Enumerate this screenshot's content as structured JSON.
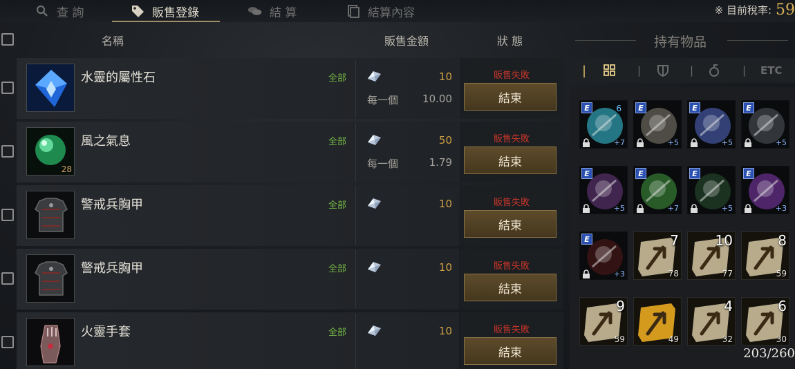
{
  "tabs": [
    {
      "label": "查 詢",
      "icon": "search-icon",
      "active": false
    },
    {
      "label": "販售登錄",
      "icon": "tag-icon",
      "active": true
    },
    {
      "label": "結 算",
      "icon": "coins-icon",
      "active": false
    },
    {
      "label": "結算內容",
      "icon": "receipt-icon",
      "active": false
    }
  ],
  "tax": {
    "label": "※ 目前稅率:",
    "value": "59"
  },
  "columns": {
    "name": "名稱",
    "price": "販售金額",
    "status": "狀 態"
  },
  "listings": [
    {
      "name": "水靈的屬性石",
      "scope": "全部",
      "price": "10",
      "per_label": "每一個",
      "per_value": "10.00",
      "status": "販售失敗",
      "button": "結束",
      "count": "",
      "icon": "water-spirit-stone-icon"
    },
    {
      "name": "風之氣息",
      "scope": "全部",
      "price": "50",
      "per_label": "每一個",
      "per_value": "1.79",
      "status": "販售失敗",
      "button": "結束",
      "count": "28",
      "icon": "green-orb-icon"
    },
    {
      "name": "警戒兵胸甲",
      "scope": "全部",
      "price": "10",
      "per_label": "",
      "per_value": "",
      "status": "販售失敗",
      "button": "結束",
      "count": "",
      "icon": "chest-armor-icon"
    },
    {
      "name": "警戒兵胸甲",
      "scope": "全部",
      "price": "10",
      "per_label": "",
      "per_value": "",
      "status": "販售失敗",
      "button": "結束",
      "count": "",
      "icon": "chest-armor-icon"
    },
    {
      "name": "火靈手套",
      "scope": "全部",
      "price": "10",
      "per_label": "",
      "per_value": "",
      "status": "販售失敗",
      "button": "結束",
      "count": "",
      "icon": "gloves-icon"
    }
  ],
  "inventory": {
    "title": "持有物品",
    "filter_etc": "ETC",
    "capacity": "203/260",
    "slots": [
      {
        "kind": "equip",
        "icon": "moon-orb-icon",
        "enh": "+7",
        "tl": "6",
        "big": "",
        "count": "",
        "color": "#2a8a9a"
      },
      {
        "kind": "equip",
        "icon": "white-cape-icon",
        "enh": "+5",
        "tl": "",
        "big": "",
        "count": "",
        "color": "#5a5850"
      },
      {
        "kind": "equip",
        "icon": "silver-armor-icon",
        "enh": "+5",
        "tl": "",
        "big": "",
        "count": "",
        "color": "#3a4a8a"
      },
      {
        "kind": "equip",
        "icon": "boots-icon",
        "enh": "+5",
        "tl": "",
        "big": "",
        "count": "",
        "color": "#3a3e44"
      },
      {
        "kind": "equip",
        "icon": "gauntlet-icon",
        "enh": "+5",
        "tl": "",
        "big": "",
        "count": "",
        "color": "#4a2a5a"
      },
      {
        "kind": "equip",
        "icon": "green-eye-icon",
        "enh": "+7",
        "tl": "",
        "big": "",
        "count": "",
        "color": "#2f6a2f"
      },
      {
        "kind": "equip",
        "icon": "dark-cloak-icon",
        "enh": "+5",
        "tl": "",
        "big": "",
        "count": "",
        "color": "#1f3a24"
      },
      {
        "kind": "equip",
        "icon": "purple-gem-icon",
        "enh": "+3",
        "tl": "",
        "big": "",
        "count": "",
        "color": "#5a2a7a"
      },
      {
        "kind": "equip",
        "icon": "necklace-icon",
        "enh": "+3",
        "tl": "",
        "big": "",
        "count": "",
        "color": "#3a1414"
      },
      {
        "kind": "scroll",
        "icon": "scroll-icon",
        "enh": "",
        "tl": "",
        "big": "7",
        "count": "78",
        "color": "#b7ab8c"
      },
      {
        "kind": "scroll",
        "icon": "scroll-icon",
        "enh": "",
        "tl": "",
        "big": "10",
        "count": "77",
        "color": "#b7ab8c"
      },
      {
        "kind": "scroll",
        "icon": "scroll-icon",
        "enh": "",
        "tl": "",
        "big": "8",
        "count": "59",
        "color": "#b7ab8c"
      },
      {
        "kind": "scroll",
        "icon": "scroll-icon",
        "enh": "",
        "tl": "",
        "big": "9",
        "count": "59",
        "color": "#b7ab8c"
      },
      {
        "kind": "scroll",
        "icon": "gold-scroll-icon",
        "enh": "",
        "tl": "",
        "big": "",
        "count": "49",
        "color": "#d49a1e"
      },
      {
        "kind": "scroll",
        "icon": "scroll-icon",
        "enh": "",
        "tl": "",
        "big": "4",
        "count": "32",
        "color": "#b7ab8c"
      },
      {
        "kind": "scroll",
        "icon": "scroll-icon",
        "enh": "",
        "tl": "",
        "big": "6",
        "count": "30",
        "color": "#b7ab8c"
      }
    ]
  }
}
